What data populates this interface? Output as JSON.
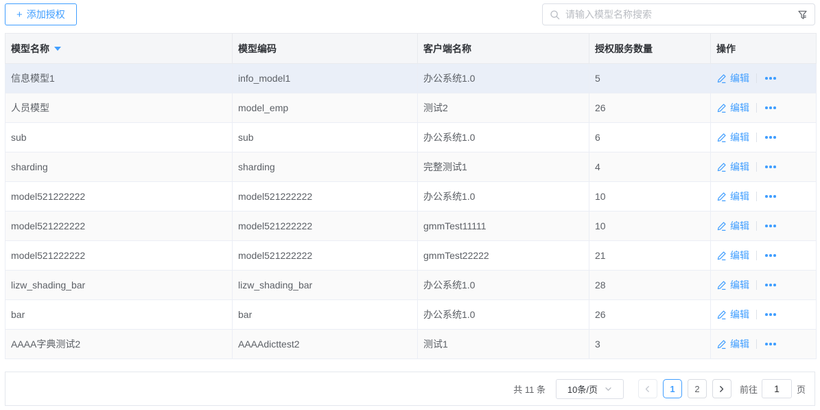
{
  "accent_color": "#409eff",
  "toolbar": {
    "add_button_icon": "+",
    "add_button_label": "添加授权",
    "search_placeholder": "请输入模型名称搜索"
  },
  "icons": {
    "add": "plus-icon",
    "search": "search-icon",
    "filter": "funnel-icon",
    "sort": "caret-down-icon",
    "edit": "pencil-icon",
    "more": "ellipsis-icon",
    "prev": "chevron-left-icon",
    "next": "chevron-right-icon",
    "select_arrow": "chevron-down-icon"
  },
  "table": {
    "columns": [
      {
        "label": "模型名称",
        "sorted": "desc"
      },
      {
        "label": "模型编码"
      },
      {
        "label": "客户端名称"
      },
      {
        "label": "授权服务数量"
      },
      {
        "label": "操作"
      }
    ],
    "edit_label": "编辑",
    "rows": [
      {
        "model_name": "信息模型1",
        "model_code": "info_model1",
        "client_name": "办公系统1.0",
        "service_count": "5",
        "highlighted": true
      },
      {
        "model_name": "人员模型",
        "model_code": "model_emp",
        "client_name": "测试2",
        "service_count": "26"
      },
      {
        "model_name": "sub",
        "model_code": "sub",
        "client_name": "办公系统1.0",
        "service_count": "6"
      },
      {
        "model_name": "sharding",
        "model_code": "sharding",
        "client_name": "完整测试1",
        "service_count": "4"
      },
      {
        "model_name": "model521222222",
        "model_code": "model521222222",
        "client_name": "办公系统1.0",
        "service_count": "10"
      },
      {
        "model_name": "model521222222",
        "model_code": "model521222222",
        "client_name": "gmmTest11111",
        "service_count": "10"
      },
      {
        "model_name": "model521222222",
        "model_code": "model521222222",
        "client_name": "gmmTest22222",
        "service_count": "21"
      },
      {
        "model_name": "lizw_shading_bar",
        "model_code": "lizw_shading_bar",
        "client_name": "办公系统1.0",
        "service_count": "28"
      },
      {
        "model_name": "bar",
        "model_code": "bar",
        "client_name": "办公系统1.0",
        "service_count": "26"
      },
      {
        "model_name": "AAAA字典测试2",
        "model_code": "AAAAdicttest2",
        "client_name": "测试1",
        "service_count": "3"
      }
    ]
  },
  "pagination": {
    "total_label": "共 11 条",
    "page_size_label": "10条/页",
    "pages": [
      "1",
      "2"
    ],
    "current_page": "1",
    "goto_label": "前往",
    "goto_value": "1",
    "page_unit_label": "页"
  }
}
